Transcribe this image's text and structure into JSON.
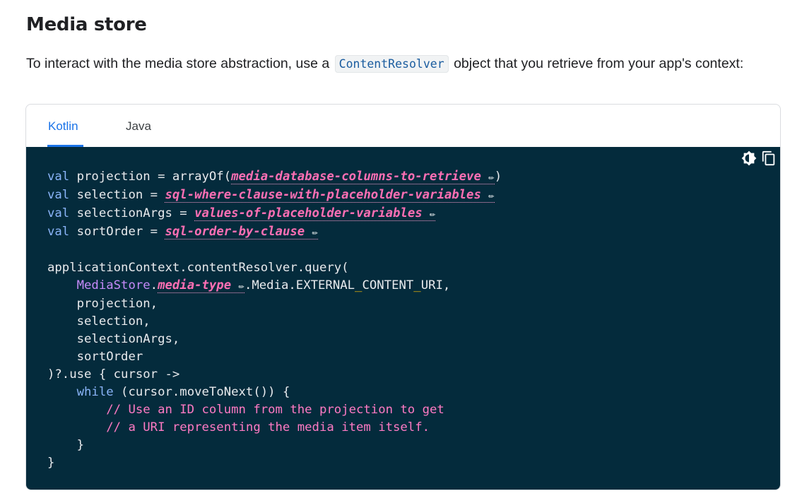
{
  "heading": "Media store",
  "intro": {
    "before": "To interact with the media store abstraction, use a ",
    "code": "ContentResolver",
    "after": " object that you retrieve from your app's context:"
  },
  "tabs": [
    {
      "label": "Kotlin",
      "active": true
    },
    {
      "label": "Java",
      "active": false
    }
  ],
  "toolbar": {
    "theme_icon": "brightness-icon",
    "copy_icon": "copy-icon"
  },
  "code": {
    "kw_val": "val",
    "kw_while": "while",
    "line1_var": "projection = arrayOf(",
    "line1_ph": "media-database-columns-to-retrieve",
    "line1_end": ")",
    "line2_var": "selection = ",
    "line2_ph": "sql-where-clause-with-placeholder-variables",
    "line3_var": "selectionArgs = ",
    "line3_ph": "values-of-placeholder-variables",
    "line4_var": "sortOrder = ",
    "line4_ph": "sql-order-by-clause",
    "query_line": "applicationContext.contentResolver.query(",
    "mediastore": "MediaStore",
    "dot": ".",
    "media_type_ph": "media-type",
    "media_rest": ".Media.EXTERNAL",
    "underscore": "_",
    "content": "CONTENT",
    "uri": "URI,",
    "arg1": "projection,",
    "arg2": "selection,",
    "arg3": "selectionArgs,",
    "arg4": "sortOrder",
    "use_line": ")?.use { cursor ->",
    "while_rest": " (cursor.moveToNext()) {",
    "comment1": "// Use an ID column from the projection to get",
    "comment2": "// a URI representing the media item itself.",
    "close_inner": "}",
    "close_outer": "}",
    "pencil": "✏"
  },
  "colors": {
    "keyword": "#8ab4f8",
    "type": "#c58af9",
    "comment": "#ff7ac4",
    "placeholder": "#ff6fb4",
    "code_bg": "#042b3c",
    "tab_active": "#1a73e8"
  }
}
